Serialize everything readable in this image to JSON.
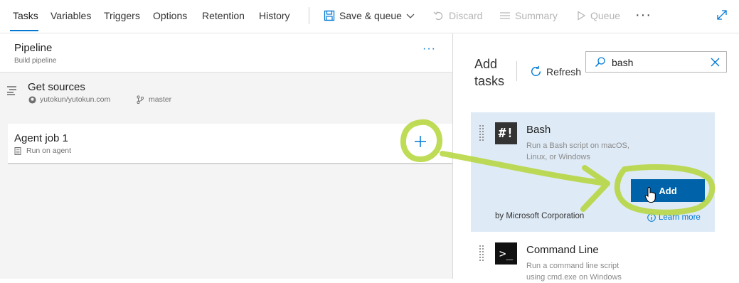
{
  "tabs": [
    {
      "label": "Tasks",
      "active": true
    },
    {
      "label": "Variables"
    },
    {
      "label": "Triggers"
    },
    {
      "label": "Options"
    },
    {
      "label": "Retention"
    },
    {
      "label": "History"
    }
  ],
  "toolbar": {
    "save_queue": "Save & queue",
    "discard": "Discard",
    "summary": "Summary",
    "queue": "Queue",
    "more": "···"
  },
  "pipeline": {
    "title": "Pipeline",
    "subtitle": "Build pipeline",
    "more": "···"
  },
  "get_sources": {
    "title": "Get sources",
    "repo": "yutokun/yutokun.com",
    "branch": "master"
  },
  "agent_job": {
    "title": "Agent job 1",
    "subtitle": "Run on agent"
  },
  "add_tasks": {
    "heading_line1": "Add",
    "heading_line2": "tasks",
    "refresh": "Refresh",
    "search_value": "bash"
  },
  "tasks": [
    {
      "title": "Bash",
      "icon_text": "#!",
      "desc_line1": "Run a Bash script on macOS,",
      "desc_line2": "Linux, or Windows",
      "add_label": "Add",
      "byline": "by Microsoft Corporation",
      "learn_more": "Learn more"
    },
    {
      "title": "Command Line",
      "icon_text": ">_",
      "desc_line1": "Run a command line script",
      "desc_line2": "using cmd.exe on Windows"
    }
  ],
  "colors": {
    "accent": "#0078d4",
    "add_button": "#0062a8",
    "selected_card": "#deeaf6",
    "annotation": "#b5d63a"
  }
}
